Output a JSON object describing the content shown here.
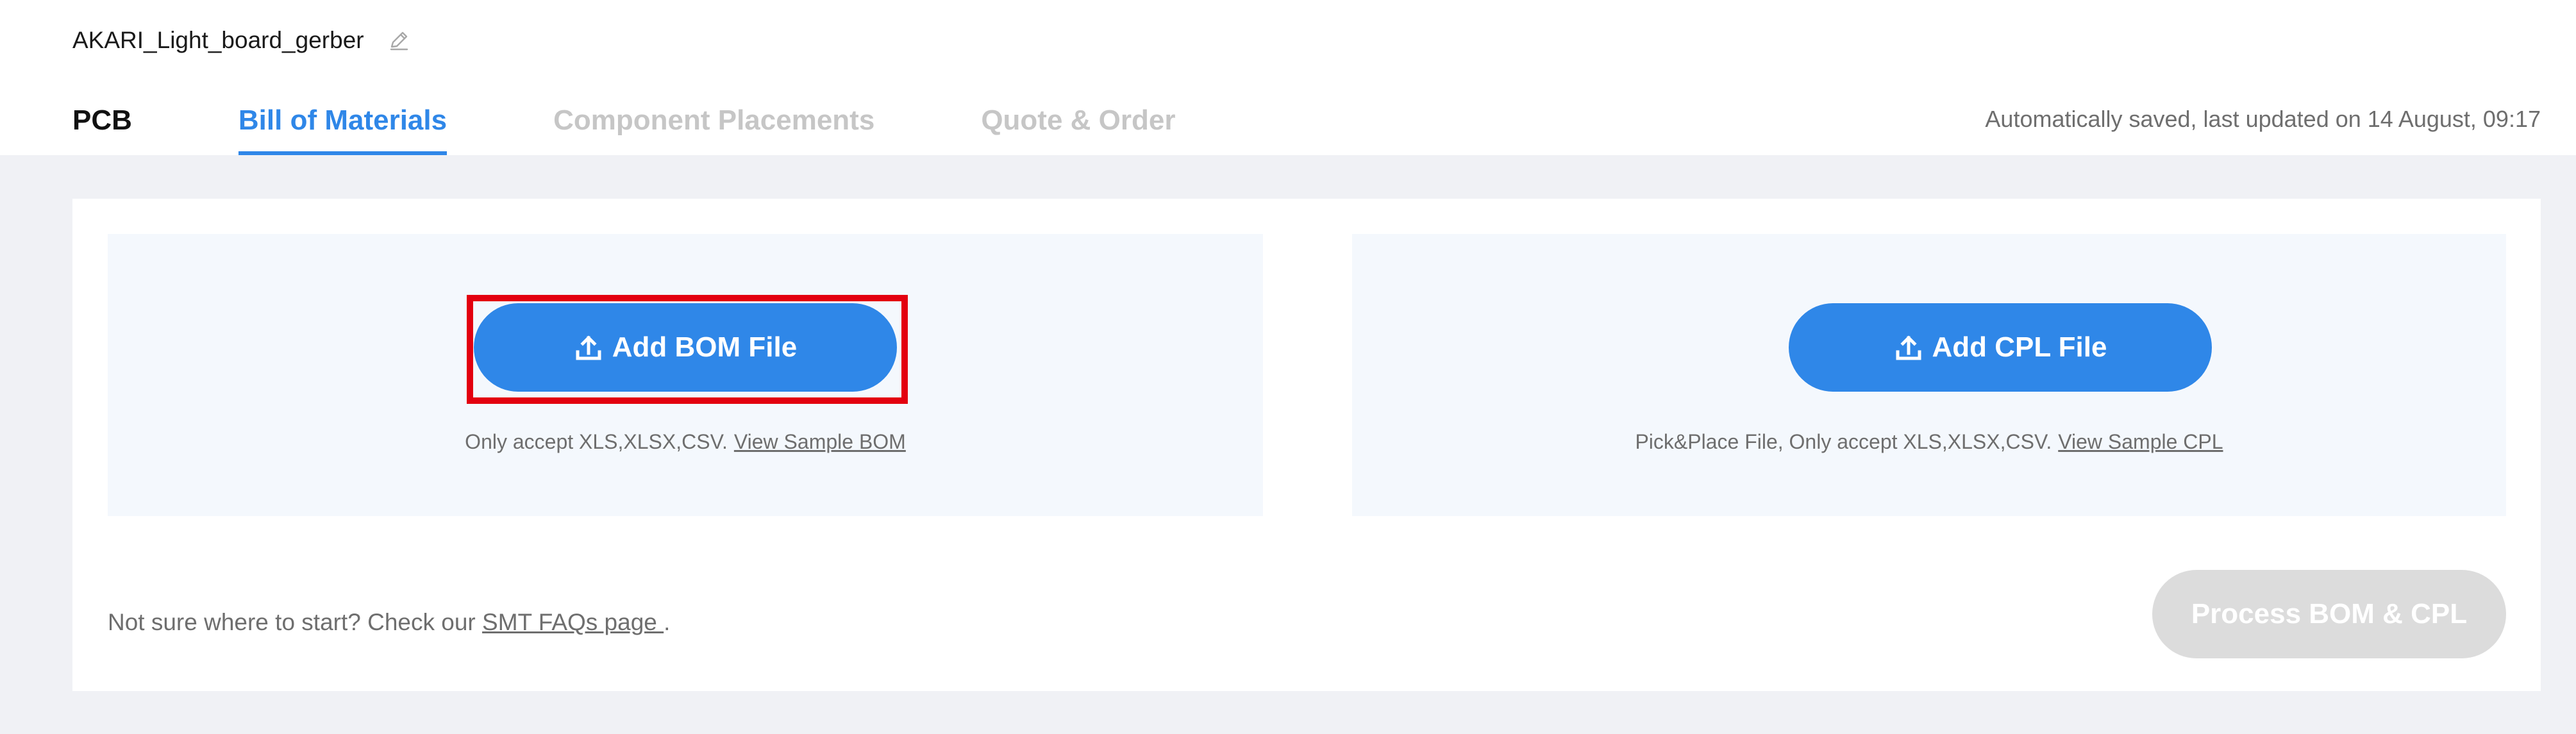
{
  "project": {
    "name": "AKARI_Light_board_gerber",
    "edit_icon": "pencil-icon"
  },
  "tabs": [
    {
      "label": "PCB",
      "state": "done"
    },
    {
      "label": "Bill of Materials",
      "state": "active"
    },
    {
      "label": "Component Placements",
      "state": "disabled"
    },
    {
      "label": "Quote & Order",
      "state": "disabled"
    }
  ],
  "save_status": "Automatically saved, last updated on 14 August, 09:17",
  "bom_panel": {
    "button_label": "Add BOM File",
    "button_icon": "upload-icon",
    "note": "Only accept XLS,XLSX,CSV.",
    "link": "View Sample BOM",
    "highlighted": true
  },
  "cpl_panel": {
    "button_label": "Add CPL File",
    "button_icon": "upload-icon",
    "note": "Pick&Place File, Only accept XLS,XLSX,CSV.",
    "link": "View Sample CPL"
  },
  "footer": {
    "prefix": "Not sure where to start? Check our",
    "link": "SMT FAQs page ",
    "suffix": "."
  },
  "process_button": {
    "label": "Process BOM & CPL",
    "enabled": false
  },
  "colors": {
    "accent": "#2f87e8",
    "highlight": "#e3000f",
    "disabled": "#dcdcdc",
    "panel_bg": "#f4f8fd",
    "page_bg": "#f0f1f5"
  }
}
